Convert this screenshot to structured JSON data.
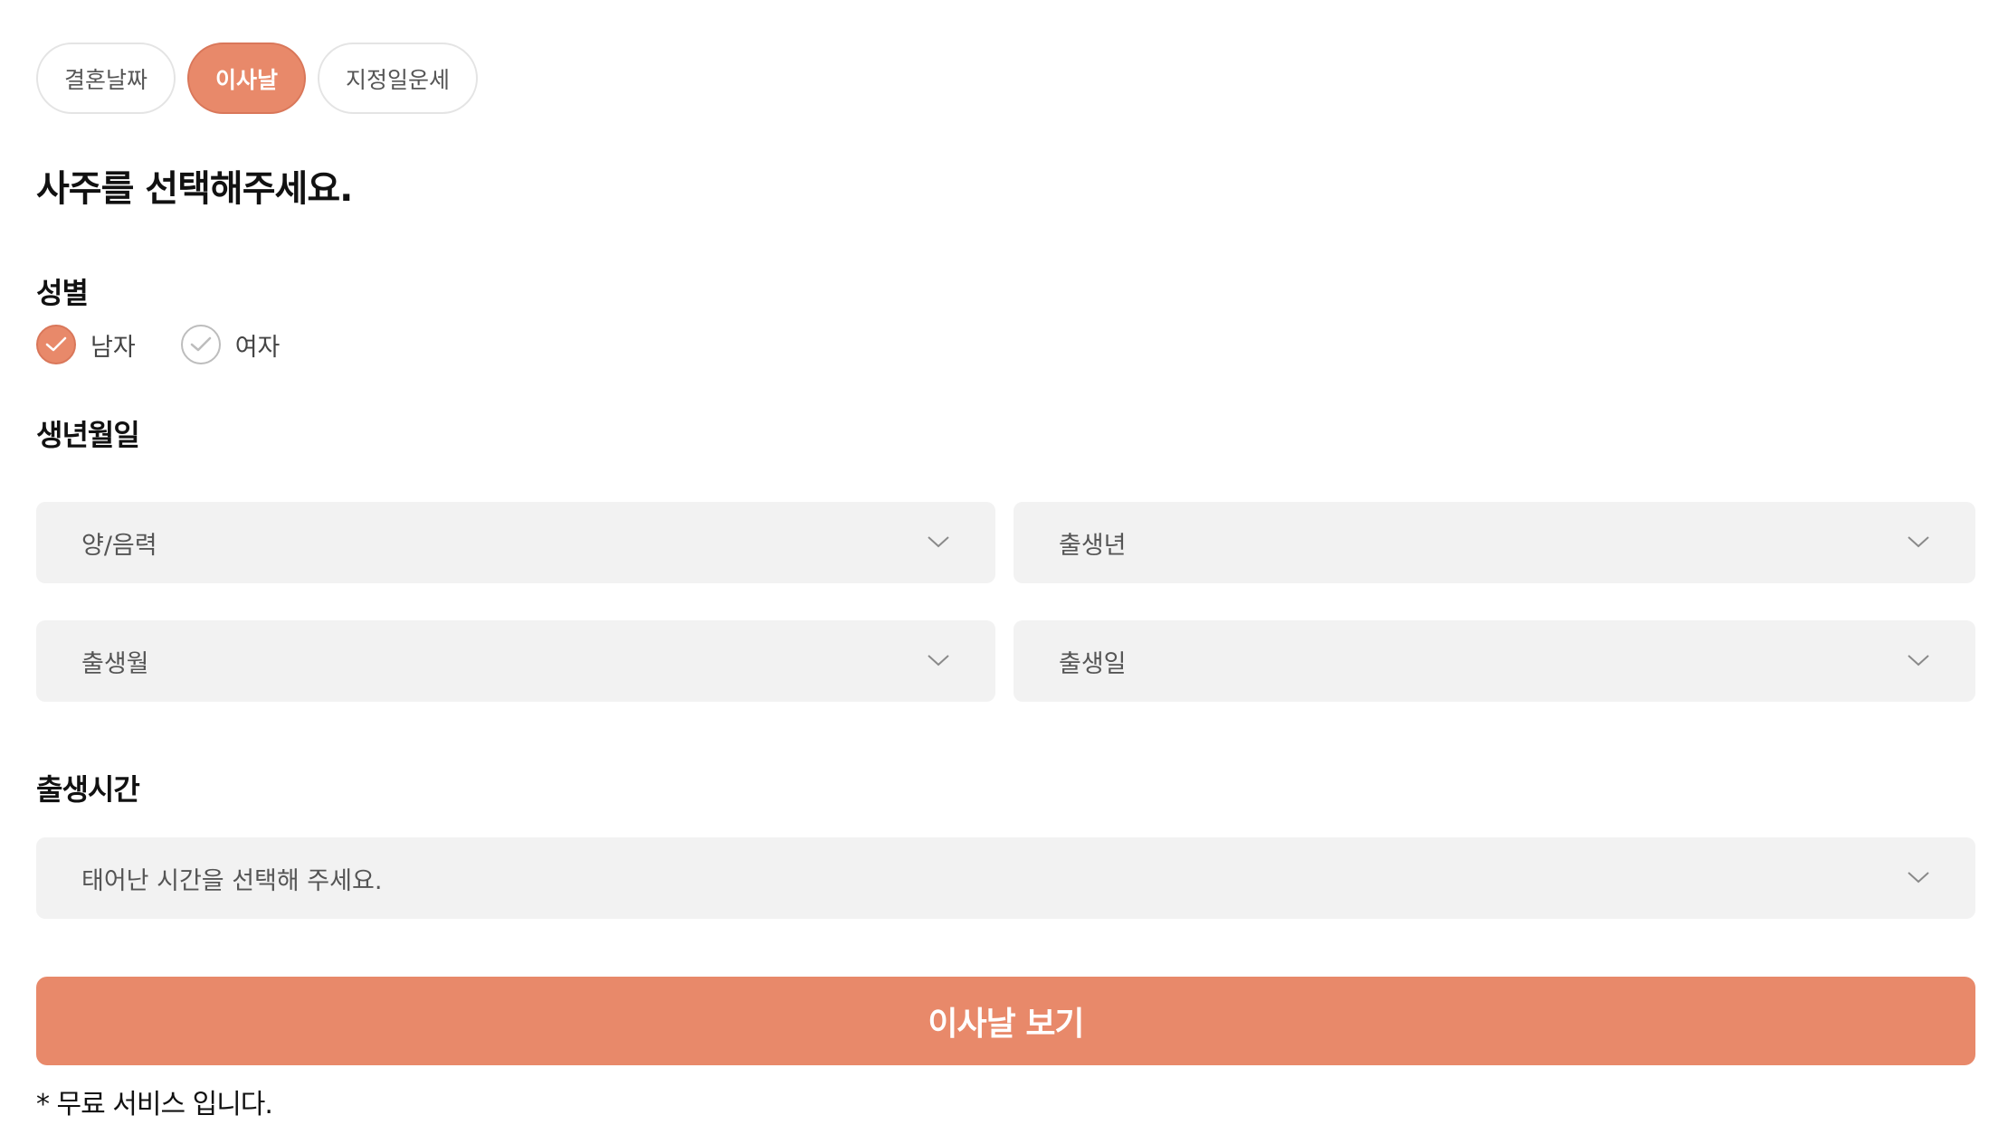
{
  "tabs": [
    {
      "label": "결혼날짜",
      "active": false
    },
    {
      "label": "이사날",
      "active": true
    },
    {
      "label": "지정일운세",
      "active": false
    }
  ],
  "title": "사주를 선택해주세요.",
  "gender": {
    "label": "성별",
    "options": [
      {
        "label": "남자",
        "checked": true
      },
      {
        "label": "여자",
        "checked": false
      }
    ]
  },
  "birth": {
    "label": "생년월일",
    "calendar_type": {
      "placeholder": "양/음력"
    },
    "year": {
      "placeholder": "출생년"
    },
    "month": {
      "placeholder": "출생월"
    },
    "day": {
      "placeholder": "출생일"
    }
  },
  "birth_time": {
    "label": "출생시간",
    "placeholder": "태어난 시간을 선택해 주세요."
  },
  "submit_label": "이사날 보기",
  "note": "* 무료 서비스 입니다.",
  "colors": {
    "accent": "#e8896a",
    "field_bg": "#f2f2f2"
  },
  "icons": {
    "dropdown": "chevron-down-icon",
    "radio_check": "check-icon"
  }
}
